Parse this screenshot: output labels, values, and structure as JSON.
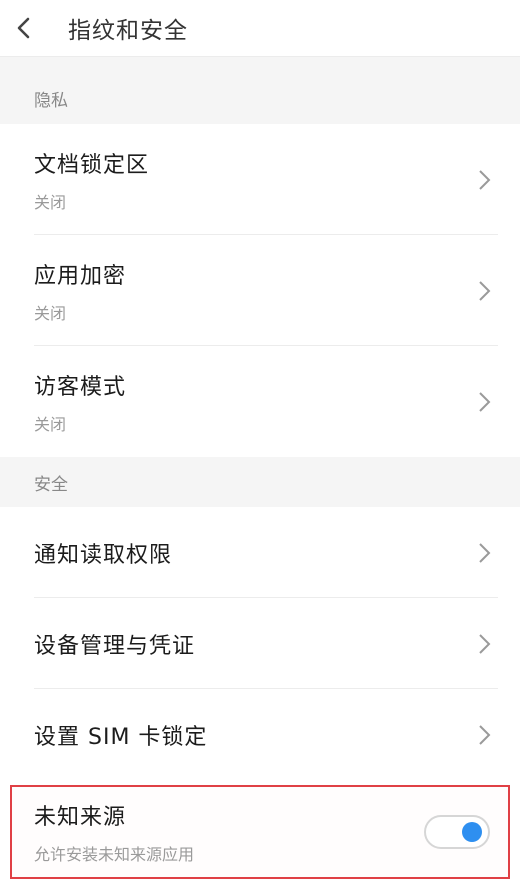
{
  "header": {
    "title": "指纹和安全"
  },
  "sections": [
    {
      "label": "隐私",
      "items": [
        {
          "title": "文档锁定区",
          "subtitle": "关闭"
        },
        {
          "title": "应用加密",
          "subtitle": "关闭"
        },
        {
          "title": "访客模式",
          "subtitle": "关闭"
        }
      ]
    },
    {
      "label": "安全",
      "items": [
        {
          "title": "通知读取权限"
        },
        {
          "title": "设备管理与凭证"
        },
        {
          "title": "设置 SIM 卡锁定"
        }
      ]
    }
  ],
  "unknown_sources": {
    "title": "未知来源",
    "subtitle": "允许安装未知来源应用",
    "enabled": true
  },
  "colors": {
    "accent": "#2e8ff0",
    "highlight_border": "#e04045",
    "section_bg": "#f5f5f5"
  }
}
